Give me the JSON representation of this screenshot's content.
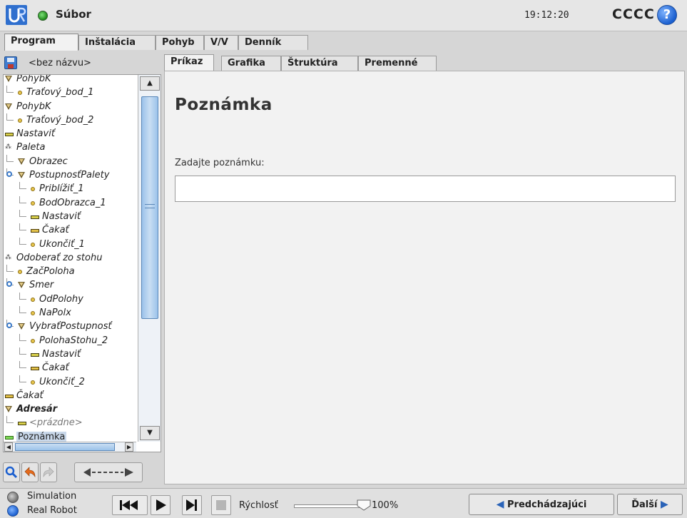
{
  "header": {
    "app_title": "Súbor",
    "clock": "19:12:20",
    "robot_name": "CCCC",
    "help_symbol": "?"
  },
  "main_tabs": [
    {
      "label": "Program",
      "active": true
    },
    {
      "label": "Inštalácia",
      "active": false
    },
    {
      "label": "Pohyb",
      "active": false
    },
    {
      "label": "V/V",
      "active": false
    },
    {
      "label": "Denník",
      "active": false
    }
  ],
  "program": {
    "file_name": "<bez názvu>",
    "tree": [
      {
        "label": "PohybK",
        "icon": "move-icon",
        "depth": 0
      },
      {
        "label": "Traťový_bod_1",
        "icon": "waypoint-icon",
        "depth": 1
      },
      {
        "label": "PohybK",
        "icon": "move-icon",
        "depth": 0
      },
      {
        "label": "Traťový_bod_2",
        "icon": "waypoint-icon",
        "depth": 1
      },
      {
        "label": "Nastaviť",
        "icon": "set-icon",
        "depth": 0
      },
      {
        "label": "Paleta",
        "icon": "pallet-icon",
        "depth": 0
      },
      {
        "label": "Obrazec",
        "icon": "move-icon",
        "depth": 1
      },
      {
        "label": "PostupnosťPalety",
        "icon": "move-icon",
        "depth": 1,
        "seq": true
      },
      {
        "label": "Priblížiť_1",
        "icon": "waypoint-icon",
        "depth": 2
      },
      {
        "label": "BodObrazca_1",
        "icon": "waypoint-icon",
        "depth": 2
      },
      {
        "label": "Nastaviť",
        "icon": "set-icon",
        "depth": 2
      },
      {
        "label": "Čakať",
        "icon": "wait-icon",
        "depth": 2
      },
      {
        "label": "Ukončiť_1",
        "icon": "waypoint-icon",
        "depth": 2
      },
      {
        "label": "Odoberať zo stohu",
        "icon": "pallet-icon",
        "depth": 0
      },
      {
        "label": "ZačPoloha",
        "icon": "waypoint-icon",
        "depth": 1
      },
      {
        "label": "Smer",
        "icon": "move-icon",
        "depth": 1,
        "seq": true
      },
      {
        "label": "OdPolohy",
        "icon": "waypoint-icon",
        "depth": 2
      },
      {
        "label": "NaPolx",
        "icon": "waypoint-icon",
        "depth": 2
      },
      {
        "label": "VybraťPostupnosť",
        "icon": "move-icon",
        "depth": 1,
        "seq": true
      },
      {
        "label": "PolohaStohu_2",
        "icon": "waypoint-icon",
        "depth": 2
      },
      {
        "label": "Nastaviť",
        "icon": "set-icon",
        "depth": 2
      },
      {
        "label": "Čakať",
        "icon": "wait-icon",
        "depth": 2
      },
      {
        "label": "Ukončiť_2",
        "icon": "waypoint-icon",
        "depth": 2
      },
      {
        "label": "Čakať",
        "icon": "wait-icon",
        "depth": 0
      },
      {
        "label": "Adresár",
        "icon": "move-icon",
        "depth": 0,
        "bold": true
      },
      {
        "label": "<prázdne>",
        "icon": "set-icon",
        "depth": 1,
        "empty": true
      },
      {
        "label": "Poznámka",
        "icon": "note-icon",
        "depth": 0,
        "selected": true
      }
    ]
  },
  "right_tabs": [
    {
      "label": "Príkaz",
      "active": true
    },
    {
      "label": "Grafika",
      "active": false
    },
    {
      "label": "Štruktúra",
      "active": false
    },
    {
      "label": "Premenné",
      "active": false
    }
  ],
  "command": {
    "title": "Poznámka",
    "field_label": "Zadajte poznámku:",
    "note_value": ""
  },
  "bottom": {
    "mode_simulation": "Simulation",
    "mode_real": "Real Robot",
    "speed_label": "Rýchlosť",
    "speed_value": "100%",
    "speed_fraction": 1.0,
    "prev_label": "Predchádzajúci",
    "next_label": "Ďalší"
  },
  "colors": {
    "accent_blue": "#1b5fcf",
    "status_green": "#1f8a1a",
    "selection": "#c9d8ea"
  }
}
